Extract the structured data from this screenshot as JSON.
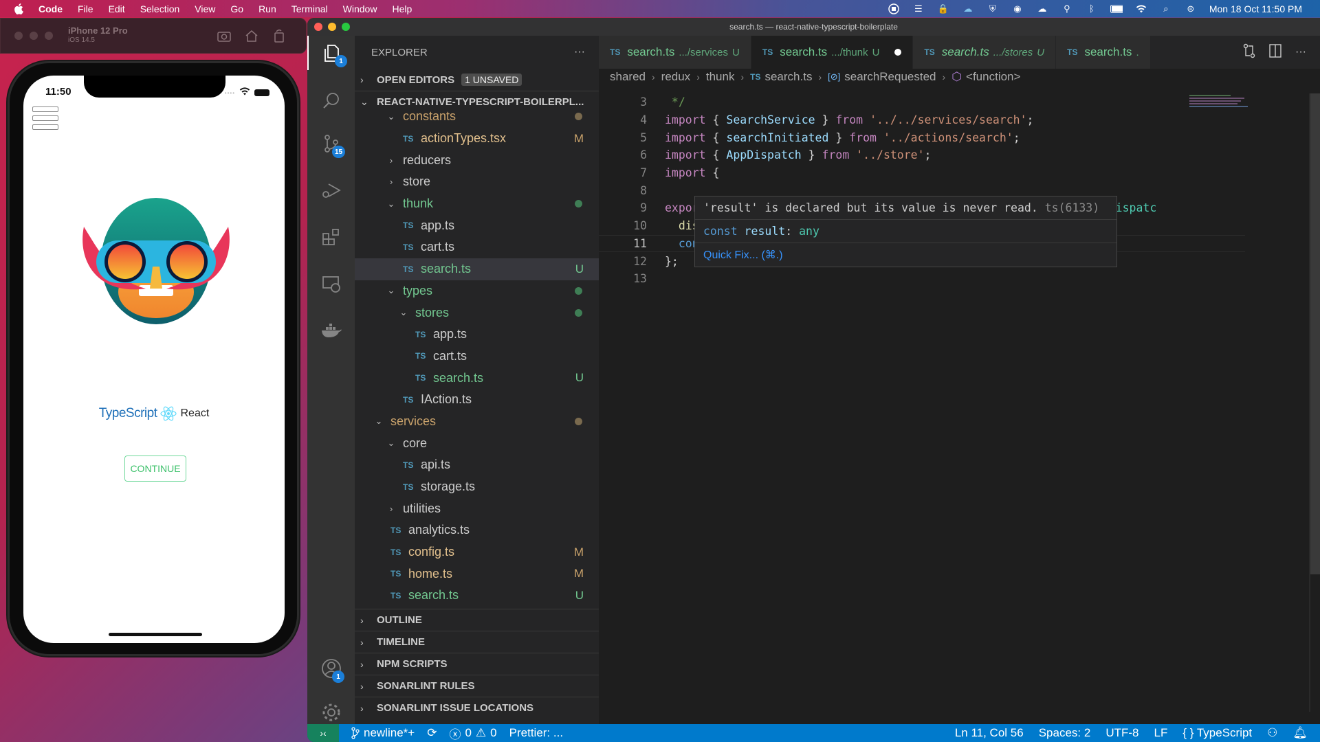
{
  "menubar": {
    "app": "Code",
    "items": [
      "File",
      "Edit",
      "Selection",
      "View",
      "Go",
      "Run",
      "Terminal",
      "Window",
      "Help"
    ],
    "tray_icons": [
      "screen-record-icon",
      "list-icon",
      "vpn-lock-icon",
      "cloud-sync-icon",
      "shield-check-icon",
      "app-icon",
      "onedrive-icon",
      "spotlight-key-icon",
      "bluetooth-icon",
      "battery-icon",
      "wifi-icon",
      "search-icon",
      "control-center-icon"
    ],
    "clock": "Mon 18 Oct  11:50 PM"
  },
  "simulator": {
    "device": "iPhone 12 Pro",
    "os": "iOS 14.5",
    "time": "11:50",
    "brand_ts": "TypeScript",
    "brand_react": "React",
    "continue_label": "CONTINUE"
  },
  "window": {
    "title": "search.ts — react-native-typescript-boilerplate"
  },
  "activity_bar": {
    "explorer_badge": "1",
    "scm_badge": "15",
    "accounts_badge": "1"
  },
  "sidebar": {
    "title": "EXPLORER",
    "more": "···",
    "open_editors": "OPEN EDITORS",
    "unsaved_badge": "1 UNSAVED",
    "project": "REACT-NATIVE-TYPESCRIPT-BOILERPL...",
    "tree": [
      {
        "label": "constants",
        "type": "folder",
        "depth": 2,
        "open": true,
        "color": "mod",
        "dot": "mod"
      },
      {
        "label": "actionTypes.tsx",
        "type": "file",
        "depth": 3,
        "color": "mod",
        "status": "M"
      },
      {
        "label": "reducers",
        "type": "folder",
        "depth": 2,
        "open": false,
        "color": "normal"
      },
      {
        "label": "store",
        "type": "folder",
        "depth": 2,
        "open": false,
        "color": "normal"
      },
      {
        "label": "thunk",
        "type": "folder",
        "depth": 2,
        "open": true,
        "color": "green",
        "dot": "green"
      },
      {
        "label": "app.ts",
        "type": "file",
        "depth": 3,
        "color": "normal"
      },
      {
        "label": "cart.ts",
        "type": "file",
        "depth": 3,
        "color": "normal"
      },
      {
        "label": "search.ts",
        "type": "file",
        "depth": 3,
        "color": "green",
        "status": "U",
        "selected": true
      },
      {
        "label": "types",
        "type": "folder",
        "depth": 2,
        "open": true,
        "color": "green",
        "dot": "green"
      },
      {
        "label": "stores",
        "type": "folder",
        "depth": 3,
        "open": true,
        "color": "green",
        "dot": "green"
      },
      {
        "label": "app.ts",
        "type": "file",
        "depth": 4,
        "color": "normal"
      },
      {
        "label": "cart.ts",
        "type": "file",
        "depth": 4,
        "color": "normal"
      },
      {
        "label": "search.ts",
        "type": "file",
        "depth": 4,
        "color": "green",
        "status": "U"
      },
      {
        "label": "IAction.ts",
        "type": "file",
        "depth": 3,
        "color": "normal"
      },
      {
        "label": "services",
        "type": "folder",
        "depth": 1,
        "open": true,
        "color": "mod",
        "dot": "mod"
      },
      {
        "label": "core",
        "type": "folder",
        "depth": 2,
        "open": true,
        "color": "normal"
      },
      {
        "label": "api.ts",
        "type": "file",
        "depth": 3,
        "color": "normal"
      },
      {
        "label": "storage.ts",
        "type": "file",
        "depth": 3,
        "color": "normal"
      },
      {
        "label": "utilities",
        "type": "folder",
        "depth": 2,
        "open": false,
        "color": "normal"
      },
      {
        "label": "analytics.ts",
        "type": "file",
        "depth": 2,
        "color": "normal"
      },
      {
        "label": "config.ts",
        "type": "file",
        "depth": 2,
        "color": "mod",
        "status": "M"
      },
      {
        "label": "home.ts",
        "type": "file",
        "depth": 2,
        "color": "mod",
        "status": "M"
      },
      {
        "label": "search.ts",
        "type": "file",
        "depth": 2,
        "color": "green",
        "status": "U"
      }
    ],
    "bottom_sections": [
      "OUTLINE",
      "TIMELINE",
      "NPM SCRIPTS",
      "SONARLINT RULES",
      "SONARLINT ISSUE LOCATIONS"
    ]
  },
  "tabs": [
    {
      "name": "search.ts",
      "path": ".../services",
      "status": "U",
      "active": false,
      "italic": false
    },
    {
      "name": "search.ts",
      "path": ".../thunk",
      "status": "U",
      "active": true,
      "italic": false,
      "dirty": true
    },
    {
      "name": "search.ts",
      "path": ".../stores",
      "status": "U",
      "active": false,
      "italic": true
    },
    {
      "name": "search.ts",
      "path": ".",
      "status": "",
      "active": false,
      "italic": false
    }
  ],
  "breadcrumb": [
    "shared",
    "redux",
    "thunk",
    "search.ts",
    "searchRequested",
    "<function>"
  ],
  "code": {
    "lines": [
      {
        "n": "3",
        "html": "<span class='cm'> */</span>"
      },
      {
        "n": "4",
        "html": "<span class='k'>import</span> { <span class='id'>SearchService</span> } <span class='k'>from</span> <span class='str'>'../../services/search'</span>;"
      },
      {
        "n": "5",
        "html": "<span class='k'>import</span> { <span class='id'>searchInitiated</span> } <span class='k'>from</span> <span class='str'>'../actions/search'</span>;"
      },
      {
        "n": "6",
        "html": "<span class='k'>import</span> { <span class='id'>AppDispatch</span> } <span class='k'>from</span> <span class='str'>'../store'</span>;"
      },
      {
        "n": "7",
        "html": "<span class='k'>import</span> {"
      },
      {
        "n": "8",
        "html": ""
      },
      {
        "n": "9",
        "html": "<span class='k'>export</span> <span class='kb'>c</span>                                                   <span class='dim'>h: </span><span class='ty'>AppDispatc</span>"
      },
      {
        "n": "10",
        "html": "  <span class='fn'>dispat</span>"
      },
      {
        "n": "11",
        "html": "  <span class='kb'>const</span> <span class='id unused'>result</span> = <span class='k'>await</span> <span class='ty'>SearchService</span>.<span class='fn'>fetch</span>(<span class='id'>data</span>.<span class='id'>query</span>);",
        "current": true
      },
      {
        "n": "12",
        "html": "};"
      },
      {
        "n": "13",
        "html": ""
      }
    ]
  },
  "hover": {
    "message": "'result' is declared but its value is never read.",
    "code": "ts(6133)",
    "signature_kw": "const",
    "signature_name": "result",
    "signature_type": "any",
    "quick_fix": "Quick Fix... (⌘.)"
  },
  "statusbar": {
    "branch": "newline*+",
    "errors": "0",
    "warnings": "0",
    "prettier": "Prettier: ...",
    "position": "Ln 11, Col 56",
    "spaces": "Spaces: 2",
    "encoding": "UTF-8",
    "eol": "LF",
    "language": "TypeScript"
  },
  "colors": {
    "accent": "#007acc",
    "git_untracked": "#73c991",
    "git_modified": "#e2c08d",
    "remote": "#16825d"
  }
}
